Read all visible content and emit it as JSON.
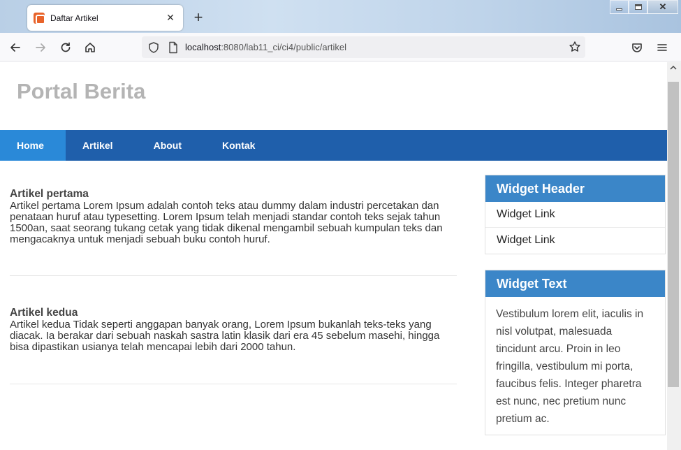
{
  "browser": {
    "tab_title": "Daftar Artikel",
    "tab_close": "✕",
    "new_tab": "+",
    "url_host": "localhost",
    "url_path": ":8080/lab11_ci/ci4/public/artikel"
  },
  "site": {
    "title": "Portal Berita",
    "nav": [
      "Home",
      "Artikel",
      "About",
      "Kontak"
    ]
  },
  "articles": [
    {
      "title": "Artikel pertama",
      "body": "Artikel pertama Lorem Ipsum adalah contoh teks atau dummy dalam industri percetakan dan penataan huruf atau typesetting. Lorem Ipsum telah menjadi standar contoh teks sejak tahun 1500an, saat seorang tukang cetak yang tidak dikenal mengambil sebuah kumpulan teks dan mengacaknya untuk menjadi sebuah buku contoh huruf."
    },
    {
      "title": "Artikel kedua",
      "body": "Artikel kedua Tidak seperti anggapan banyak orang, Lorem Ipsum bukanlah teks-teks yang diacak. Ia berakar dari sebuah naskah sastra latin klasik dari era 45 sebelum masehi, hingga bisa dipastikan usianya telah mencapai lebih dari 2000 tahun."
    }
  ],
  "sidebar": {
    "widget_header": "Widget Header",
    "widget_links": [
      "Widget Link",
      "Widget Link"
    ],
    "widget_text_title": "Widget Text",
    "widget_text_body": "Vestibulum lorem elit, iaculis in nisl volutpat, malesuada tincidunt arcu. Proin in leo fringilla, vestibulum mi porta, faucibus felis. Integer pharetra est nunc, nec pretium nunc pretium ac."
  },
  "colors": {
    "nav_bg": "#1f5fab",
    "nav_active": "#2a89d8",
    "widget_header": "#3b86c8",
    "site_title": "#b4b4b4"
  }
}
